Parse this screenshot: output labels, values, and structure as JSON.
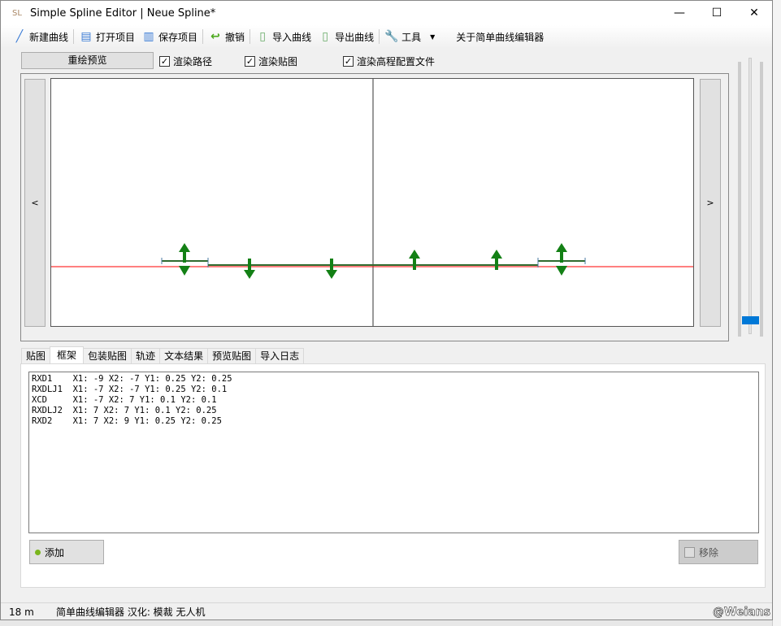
{
  "window": {
    "title": "Simple Spline Editor | Neue Spline*",
    "min": "—",
    "max": "☐",
    "close": "✕"
  },
  "toolbar": {
    "new_curve": "新建曲线",
    "open_project": "打开项目",
    "save_project": "保存项目",
    "undo": "撤销",
    "import_curve": "导入曲线",
    "export_curve": "导出曲线",
    "tools": "工具",
    "about": "关于简单曲线编辑器"
  },
  "options": {
    "redraw": "重绘预览",
    "render_path": "渲染路径",
    "render_texture": "渲染贴图",
    "render_elevation": "渲染高程配置文件",
    "render_path_checked": true,
    "render_texture_checked": true,
    "render_elevation_checked": true
  },
  "viewport": {
    "prev": "<",
    "next": ">",
    "zoom_slider_value": 0.05
  },
  "tabs": [
    "贴图",
    "框架",
    "包装贴图",
    "轨迹",
    "文本结果",
    "预览贴图",
    "导入日志"
  ],
  "active_tab": 1,
  "frames": [
    "RXD1    X1: -9 X2: -7 Y1: 0.25 Y2: 0.25",
    "RXDLJ1  X1: -7 X2: -7 Y1: 0.25 Y2: 0.1",
    "XCD     X1: -7 X2: 7 Y1: 0.1 Y2: 0.1",
    "RXDLJ2  X1: 7 X2: 7 Y1: 0.1 Y2: 0.25",
    "RXD2    X1: 7 X2: 9 Y1: 0.25 Y2: 0.25"
  ],
  "buttons": {
    "add": "添加",
    "remove": "移除"
  },
  "status": {
    "length": "18 m",
    "credits": "简单曲线编辑器 汉化: 模裁 无人机",
    "watermark": "@Weians"
  },
  "colors": {
    "accent": "#0078d7",
    "arrow": "#138015",
    "spline": "#2f6b2f",
    "baseline": "#ff0000"
  }
}
